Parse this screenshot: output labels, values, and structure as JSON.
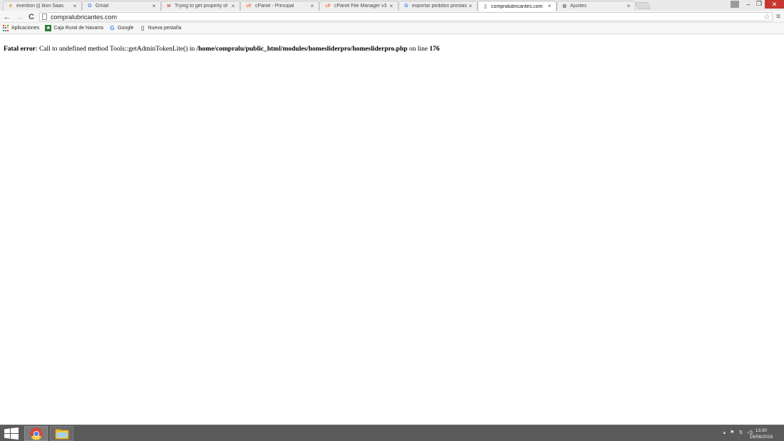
{
  "tabs": [
    {
      "title": "everilion ||| Ilion Saas",
      "icon": "everilion-favicon",
      "color": "#f08a24",
      "glyph": "e"
    },
    {
      "title": "Gmail",
      "icon": "google-favicon",
      "color": "#4285f4",
      "glyph": "G"
    },
    {
      "title": "Trying to get property of",
      "icon": "stackoverflow-favicon",
      "color": "#d9534f",
      "glyph": "w"
    },
    {
      "title": "cPanel - Principal",
      "icon": "cpanel-favicon",
      "color": "#ff6c2c",
      "glyph": "cP"
    },
    {
      "title": "cPanel File Manager v3",
      "icon": "cpanel-favicon",
      "color": "#ff6c2c",
      "glyph": "cP"
    },
    {
      "title": "exportar pedidos prestas",
      "icon": "google-favicon",
      "color": "#4285f4",
      "glyph": "G"
    },
    {
      "title": "compralubricantes.com",
      "icon": "page-favicon",
      "color": "#888888",
      "glyph": "▯",
      "active": true
    },
    {
      "title": "Ajustes",
      "icon": "gear-icon",
      "color": "#666666",
      "glyph": "⚙"
    }
  ],
  "tab_close_glyph": "×",
  "window_controls": {
    "minimize": "–",
    "maximize": "❐",
    "close": "✕"
  },
  "toolbar": {
    "back": "←",
    "forward": "→",
    "reload": "C",
    "url": "compralubricantes.com",
    "star": "☆",
    "menu": "≡"
  },
  "bookmarks": [
    {
      "label": "Aplicaciones",
      "icon": "apps-grid-icon"
    },
    {
      "label": "Caja Rural de Navarra",
      "icon": "caja-rural-icon",
      "color": "#2e7d32",
      "glyph": "♣"
    },
    {
      "label": "Google",
      "icon": "google-favicon",
      "color": "#4285f4",
      "glyph": "G"
    },
    {
      "label": "Nueva pestaña",
      "icon": "page-icon",
      "color": "#777777",
      "glyph": "▯"
    }
  ],
  "error": {
    "label": "Fatal error",
    "message": ": Call to undefined method Tools::getAdminTokenLite() in ",
    "path": "/home/compralu/public_html/modules/homesliderpro/homesliderpro.php",
    "middle": " on line ",
    "line": "176"
  },
  "taskbar": {
    "apps": [
      "chrome",
      "file-explorer"
    ],
    "tray": [
      "▴",
      "⚑",
      "⇅",
      "◁)"
    ],
    "time": "13:30",
    "date": "16/08/2016"
  },
  "colors": {
    "close_button": "#c7372f",
    "taskbar": "#5b5b5b"
  }
}
